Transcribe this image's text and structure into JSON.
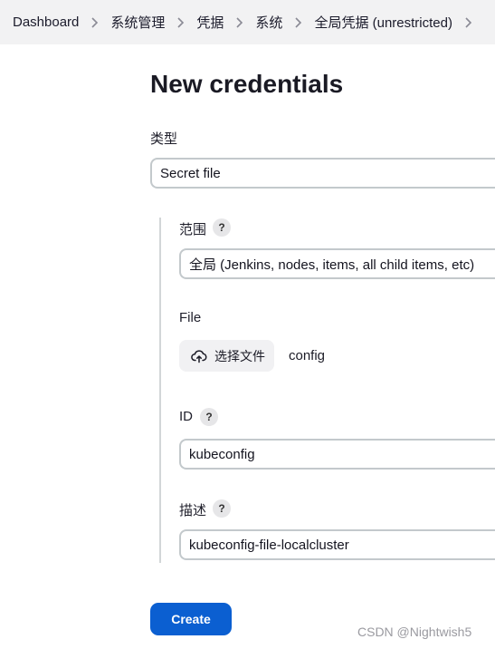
{
  "breadcrumb": {
    "items": [
      {
        "label": "Dashboard"
      },
      {
        "label": "系统管理"
      },
      {
        "label": "凭据"
      },
      {
        "label": "系统"
      },
      {
        "label": "全局凭据 (unrestricted)"
      }
    ]
  },
  "page": {
    "title": "New credentials"
  },
  "form": {
    "kind_label": "类型",
    "kind_value": "Secret file",
    "scope_label": "范围",
    "scope_value": "全局 (Jenkins, nodes, items, all child items, etc)",
    "file_label": "File",
    "file_button": "选择文件",
    "file_name": "config",
    "id_label": "ID",
    "id_value": "kubeconfig",
    "desc_label": "描述",
    "desc_value": "kubeconfig-file-localcluster",
    "help_glyph": "?"
  },
  "actions": {
    "create_label": "Create"
  },
  "watermark": "CSDN @Nightwish5",
  "colors": {
    "accent": "#0b5fd1",
    "breadcrumb_bg": "#f2f2f3",
    "field_border": "#c3c9cc"
  }
}
